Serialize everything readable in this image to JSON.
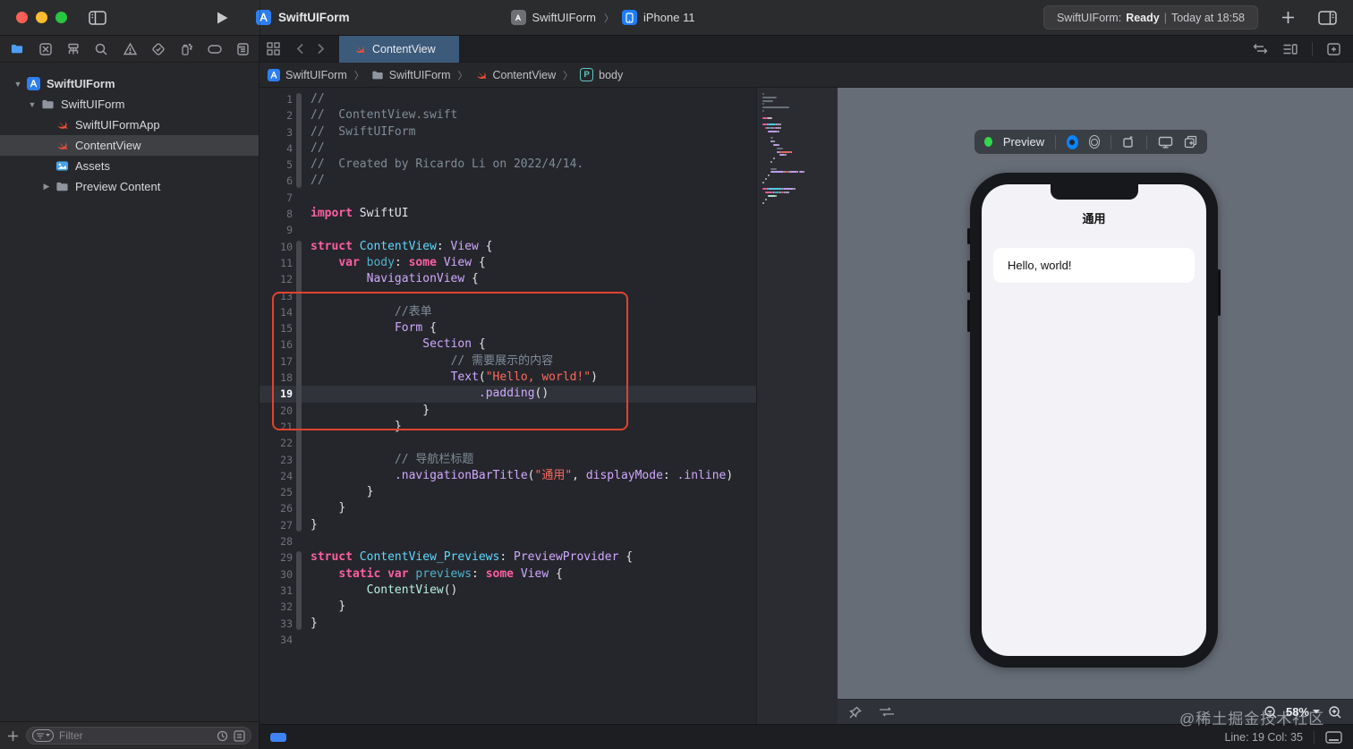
{
  "colors": {
    "accent_blue": "#0a84ff",
    "annotation_red": "#e2432e",
    "tab_selected": "#3c5a7a",
    "swift_orange": "#f05138",
    "canvas_bg": "#666d77"
  },
  "titlebar": {
    "title": "SwiftUIForm",
    "scheme": {
      "project": "SwiftUIForm",
      "destination": "iPhone 11"
    },
    "status": {
      "project": "SwiftUIForm:",
      "state": "Ready",
      "divider": "|",
      "time": "Today at 18:58"
    }
  },
  "sidebar": {
    "items": [
      {
        "label": "SwiftUIForm",
        "kind": "project"
      },
      {
        "label": "SwiftUIForm",
        "kind": "group"
      },
      {
        "label": "SwiftUIFormApp",
        "kind": "swift-file"
      },
      {
        "label": "ContentView",
        "kind": "swift-file",
        "selected": true
      },
      {
        "label": "Assets",
        "kind": "asset-catalog"
      },
      {
        "label": "Preview Content",
        "kind": "group"
      }
    ],
    "filter_placeholder": "Filter"
  },
  "editor": {
    "tab": "ContentView",
    "breadcrumb": [
      "SwiftUIForm",
      "SwiftUIForm",
      "ContentView",
      "body"
    ],
    "breadcrumb_sep": "〉",
    "current_line": 19,
    "fold_ranges": [
      [
        1,
        6
      ],
      [
        10,
        27
      ],
      [
        29,
        33
      ]
    ],
    "lines": [
      {
        "n": 1,
        "ind": 0,
        "segs": [
          [
            "c",
            "//"
          ]
        ]
      },
      {
        "n": 2,
        "ind": 0,
        "segs": [
          [
            "c",
            "//  ContentView.swift"
          ]
        ]
      },
      {
        "n": 3,
        "ind": 0,
        "segs": [
          [
            "c",
            "//  SwiftUIForm"
          ]
        ]
      },
      {
        "n": 4,
        "ind": 0,
        "segs": [
          [
            "c",
            "//"
          ]
        ]
      },
      {
        "n": 5,
        "ind": 0,
        "segs": [
          [
            "c",
            "//  Created by Ricardo Li on 2022/4/14."
          ]
        ]
      },
      {
        "n": 6,
        "ind": 0,
        "segs": [
          [
            "c",
            "//"
          ]
        ]
      },
      {
        "n": 7,
        "ind": 0,
        "segs": []
      },
      {
        "n": 8,
        "ind": 0,
        "segs": [
          [
            "k",
            "import"
          ],
          [
            "p",
            " SwiftUI"
          ]
        ]
      },
      {
        "n": 9,
        "ind": 0,
        "segs": []
      },
      {
        "n": 10,
        "ind": 0,
        "segs": [
          [
            "k",
            "struct"
          ],
          [
            "p",
            " "
          ],
          [
            "tp",
            "ContentView"
          ],
          [
            "p",
            ": "
          ],
          [
            "ts",
            "View"
          ],
          [
            "p",
            " {"
          ]
        ]
      },
      {
        "n": 11,
        "ind": 4,
        "segs": [
          [
            "k",
            "var"
          ],
          [
            "p",
            " "
          ],
          [
            "d",
            "body"
          ],
          [
            "p",
            ": "
          ],
          [
            "k",
            "some"
          ],
          [
            "p",
            " "
          ],
          [
            "ts",
            "View"
          ],
          [
            "p",
            " {"
          ]
        ]
      },
      {
        "n": 12,
        "ind": 8,
        "segs": [
          [
            "ts",
            "NavigationView"
          ],
          [
            "p",
            " {"
          ]
        ]
      },
      {
        "n": 13,
        "ind": 0,
        "segs": []
      },
      {
        "n": 14,
        "ind": 12,
        "segs": [
          [
            "c",
            "//表单"
          ]
        ]
      },
      {
        "n": 15,
        "ind": 12,
        "segs": [
          [
            "ts",
            "Form"
          ],
          [
            "p",
            " {"
          ]
        ]
      },
      {
        "n": 16,
        "ind": 16,
        "segs": [
          [
            "ts",
            "Section"
          ],
          [
            "p",
            " {"
          ]
        ]
      },
      {
        "n": 17,
        "ind": 20,
        "segs": [
          [
            "c",
            "// 需要展示的内容"
          ]
        ]
      },
      {
        "n": 18,
        "ind": 20,
        "segs": [
          [
            "ts",
            "Text"
          ],
          [
            "p",
            "("
          ],
          [
            "s",
            "\"Hello, world!\""
          ],
          [
            "p",
            ")"
          ]
        ]
      },
      {
        "n": 19,
        "ind": 24,
        "segs": [
          [
            "ts",
            ".padding"
          ],
          [
            "p",
            "()"
          ]
        ]
      },
      {
        "n": 20,
        "ind": 16,
        "segs": [
          [
            "p",
            "}"
          ]
        ]
      },
      {
        "n": 21,
        "ind": 12,
        "segs": [
          [
            "p",
            "}"
          ]
        ]
      },
      {
        "n": 22,
        "ind": 0,
        "segs": []
      },
      {
        "n": 23,
        "ind": 12,
        "segs": [
          [
            "c",
            "// 导航栏标题"
          ]
        ]
      },
      {
        "n": 24,
        "ind": 12,
        "segs": [
          [
            "ts",
            ".navigationBarTitle"
          ],
          [
            "p",
            "("
          ],
          [
            "s",
            "\"通用\""
          ],
          [
            "p",
            ", "
          ],
          [
            "ts",
            "displayMode"
          ],
          [
            "p",
            ": "
          ],
          [
            "ts",
            ".inline"
          ],
          [
            "p",
            ")"
          ]
        ]
      },
      {
        "n": 25,
        "ind": 8,
        "segs": [
          [
            "p",
            "}"
          ]
        ]
      },
      {
        "n": 26,
        "ind": 4,
        "segs": [
          [
            "p",
            "}"
          ]
        ]
      },
      {
        "n": 27,
        "ind": 0,
        "segs": [
          [
            "p",
            "}"
          ]
        ]
      },
      {
        "n": 28,
        "ind": 0,
        "segs": []
      },
      {
        "n": 29,
        "ind": 0,
        "segs": [
          [
            "k",
            "struct"
          ],
          [
            "p",
            " "
          ],
          [
            "tp",
            "ContentView_Previews"
          ],
          [
            "p",
            ": "
          ],
          [
            "ts",
            "PreviewProvider"
          ],
          [
            "p",
            " {"
          ]
        ]
      },
      {
        "n": 30,
        "ind": 4,
        "segs": [
          [
            "k",
            "static"
          ],
          [
            "p",
            " "
          ],
          [
            "k",
            "var"
          ],
          [
            "p",
            " "
          ],
          [
            "d",
            "previews"
          ],
          [
            "p",
            ": "
          ],
          [
            "k",
            "some"
          ],
          [
            "p",
            " "
          ],
          [
            "ts",
            "View"
          ],
          [
            "p",
            " {"
          ]
        ]
      },
      {
        "n": 31,
        "ind": 8,
        "segs": [
          [
            "m",
            "ContentView"
          ],
          [
            "p",
            "()"
          ]
        ]
      },
      {
        "n": 32,
        "ind": 4,
        "segs": [
          [
            "p",
            "}"
          ]
        ]
      },
      {
        "n": 33,
        "ind": 0,
        "segs": [
          [
            "p",
            "}"
          ]
        ]
      },
      {
        "n": 34,
        "ind": 0,
        "segs": []
      }
    ]
  },
  "canvas": {
    "preview_label": "Preview",
    "zoom_level": "58%",
    "phone": {
      "nav_title": "通用",
      "cell_text": "Hello, world!"
    }
  },
  "statusbar": {
    "line_col": "Line: 19  Col: 35"
  },
  "watermark": "@稀土掘金技术社区"
}
